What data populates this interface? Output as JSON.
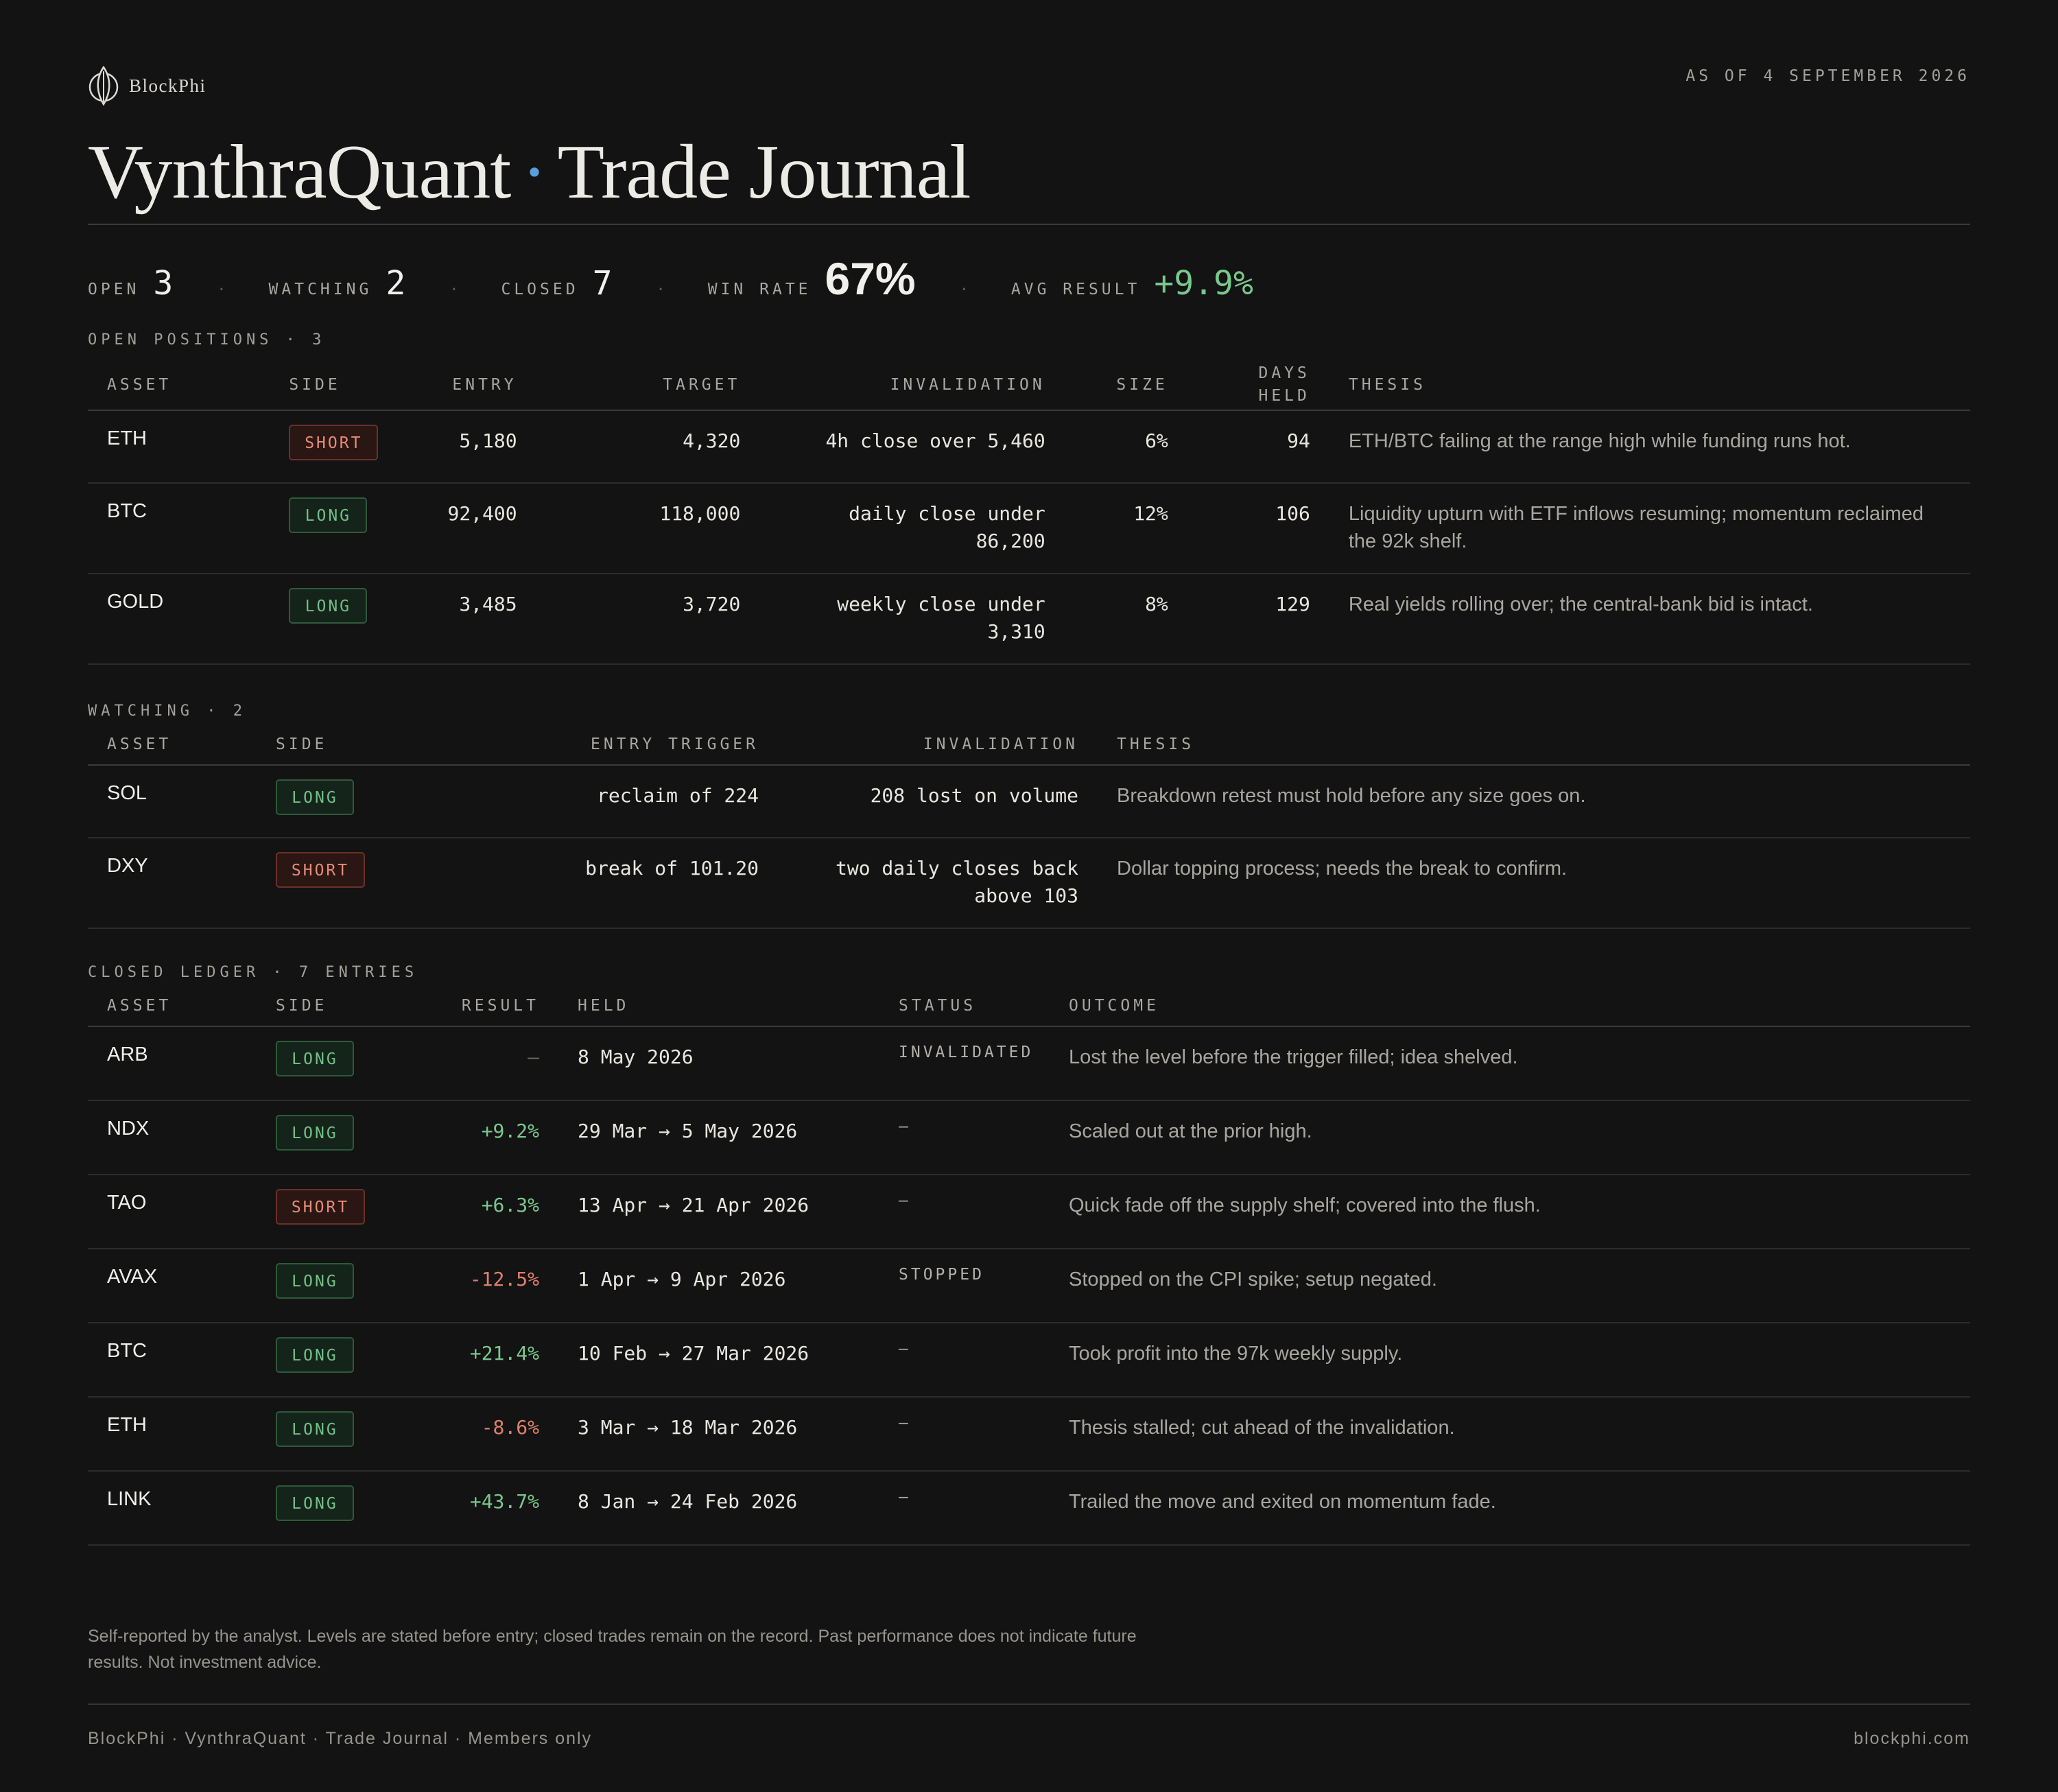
{
  "brand": {
    "name": "BlockPhi",
    "logo_icon": "leaf-circle-icon"
  },
  "as_of": "AS OF 4 SEPTEMBER 2026",
  "title": {
    "left": "VynthraQuant",
    "separator": "·",
    "right": "Trade Journal"
  },
  "colors": {
    "accent": "#5b9ddc",
    "positive": "#79c88d",
    "negative": "#e0806a",
    "background": "#131313"
  },
  "stats": {
    "open_label": "OPEN",
    "open_value": "3",
    "watching_label": "WATCHING",
    "watching_value": "2",
    "closed_label": "CLOSED",
    "closed_value": "7",
    "winrate_label": "WIN RATE",
    "winrate_value": "67%",
    "avg_label": "AVG RESULT",
    "avg_value": "+9.9%",
    "sep": "·"
  },
  "open_positions": {
    "label": "OPEN POSITIONS · 3",
    "headers": {
      "asset": "ASSET",
      "side": "SIDE",
      "entry": "ENTRY",
      "target": "TARGET",
      "invalidation": "INVALIDATION",
      "size": "SIZE",
      "days_held_1": "DAYS",
      "days_held_2": "HELD",
      "thesis": "THESIS"
    },
    "rows": [
      {
        "asset": "ETH",
        "side": "SHORT",
        "entry": "5,180",
        "target": "4,320",
        "invalidation": "4h close over 5,460",
        "size": "6%",
        "days": "94",
        "thesis": "ETH/BTC failing at the range high while funding runs hot."
      },
      {
        "asset": "BTC",
        "side": "LONG",
        "entry": "92,400",
        "target": "118,000",
        "invalidation": "daily close under 86,200",
        "size": "12%",
        "days": "106",
        "thesis": "Liquidity upturn with ETF inflows resuming; momentum reclaimed the 92k shelf."
      },
      {
        "asset": "GOLD",
        "side": "LONG",
        "entry": "3,485",
        "target": "3,720",
        "invalidation": "weekly close under 3,310",
        "size": "8%",
        "days": "129",
        "thesis": "Real yields rolling over; the central-bank bid is intact."
      }
    ]
  },
  "watching": {
    "label": "WATCHING · 2",
    "headers": {
      "asset": "ASSET",
      "side": "SIDE",
      "entry_trigger": "ENTRY TRIGGER",
      "invalidation": "INVALIDATION",
      "thesis": "THESIS"
    },
    "rows": [
      {
        "asset": "SOL",
        "side": "LONG",
        "trigger": "reclaim of 224",
        "invalidation": "208 lost on volume",
        "thesis": "Breakdown retest must hold before any size goes on."
      },
      {
        "asset": "DXY",
        "side": "SHORT",
        "trigger": "break of 101.20",
        "invalidation": "two daily closes back above 103",
        "thesis": "Dollar topping process; needs the break to confirm."
      }
    ]
  },
  "closed": {
    "label": "CLOSED LEDGER · 7 ENTRIES",
    "headers": {
      "asset": "ASSET",
      "side": "SIDE",
      "result": "RESULT",
      "held": "HELD",
      "status": "STATUS",
      "outcome": "OUTCOME"
    },
    "rows": [
      {
        "asset": "ARB",
        "side": "LONG",
        "result": "–",
        "tone": "dim",
        "held": "8 May 2026",
        "status": "INVALIDATED",
        "outcome": "Lost the level before the trigger filled; idea shelved."
      },
      {
        "asset": "NDX",
        "side": "LONG",
        "result": "+9.2%",
        "tone": "pos",
        "held": "29 Mar → 5 May 2026",
        "status": "–",
        "outcome": "Scaled out at the prior high."
      },
      {
        "asset": "TAO",
        "side": "SHORT",
        "result": "+6.3%",
        "tone": "pos",
        "held": "13 Apr → 21 Apr 2026",
        "status": "–",
        "outcome": "Quick fade off the supply shelf; covered into the flush."
      },
      {
        "asset": "AVAX",
        "side": "LONG",
        "result": "-12.5%",
        "tone": "neg",
        "held": "1 Apr → 9 Apr 2026",
        "status": "STOPPED",
        "outcome": "Stopped on the CPI spike; setup negated."
      },
      {
        "asset": "BTC",
        "side": "LONG",
        "result": "+21.4%",
        "tone": "pos",
        "held": "10 Feb → 27 Mar 2026",
        "status": "–",
        "outcome": "Took profit into the 97k weekly supply."
      },
      {
        "asset": "ETH",
        "side": "LONG",
        "result": "-8.6%",
        "tone": "neg",
        "held": "3 Mar → 18 Mar 2026",
        "status": "–",
        "outcome": "Thesis stalled; cut ahead of the invalidation."
      },
      {
        "asset": "LINK",
        "side": "LONG",
        "result": "+43.7%",
        "tone": "pos",
        "held": "8 Jan → 24 Feb 2026",
        "status": "–",
        "outcome": "Trailed the move and exited on momentum fade."
      }
    ]
  },
  "disclaimer": "Self-reported by the analyst. Levels are stated before entry; closed trades remain on the record. Past performance does not indicate future results. Not investment advice.",
  "footer": {
    "left": "BlockPhi · VynthraQuant · Trade Journal · Members only",
    "right": "blockphi.com"
  }
}
